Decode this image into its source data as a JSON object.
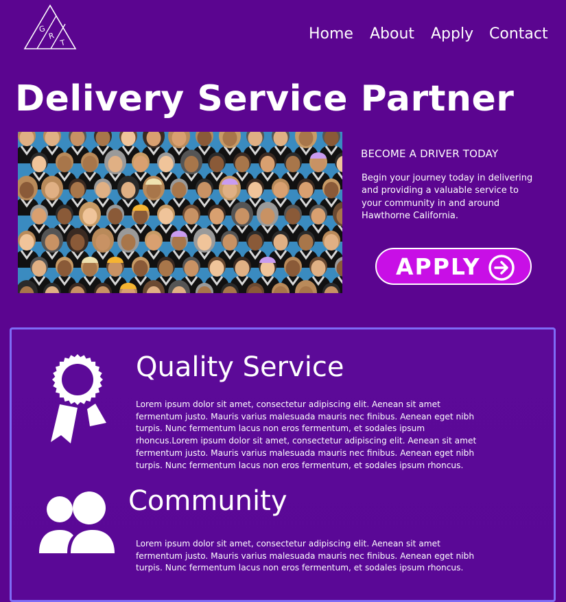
{
  "brand": {
    "logo_letters": [
      "G",
      "R",
      "T"
    ],
    "icon": "triangle-logo-icon"
  },
  "nav": {
    "items": [
      {
        "label": "Home"
      },
      {
        "label": "About"
      },
      {
        "label": "Apply"
      },
      {
        "label": "Contact"
      }
    ]
  },
  "hero": {
    "title": "Delivery Service Partner",
    "image": "crowd-of-drivers-illustration",
    "cta_heading": "BECOME A DRIVER TODAY",
    "cta_body": "Begin your journey today in delivering and providing a valuable service to your community in and around Hawthorne California.",
    "apply_label": "APPLY",
    "apply_icon": "arrow-right-circle-icon"
  },
  "features": [
    {
      "icon": "award-ribbon-icon",
      "title": "Quality Service",
      "body": "Lorem ipsum dolor sit amet, consectetur adipiscing elit. Aenean sit amet fermentum justo. Mauris varius malesuada mauris nec finibus. Aenean eget nibh turpis. Nunc fermentum lacus non eros fermentum, et sodales ipsum rhoncus.Lorem ipsum dolor sit amet, consectetur adipiscing elit. Aenean sit amet fermentum justo. Mauris varius malesuada mauris nec finibus. Aenean eget nibh turpis. Nunc fermentum lacus non eros fermentum, et sodales ipsum rhoncus."
    },
    {
      "icon": "people-group-icon",
      "title": "Community",
      "body": "Lorem ipsum dolor sit amet, consectetur adipiscing elit. Aenean sit amet fermentum justo. Mauris varius malesuada mauris nec finibus. Aenean eget nibh turpis. Nunc fermentum lacus non eros fermentum, et sodales ipsum rhoncus."
    }
  ],
  "colors": {
    "background": "#5b0590",
    "accent_button": "#c80fe6",
    "panel_border": "#7e6cf6",
    "text": "#ffffff"
  }
}
